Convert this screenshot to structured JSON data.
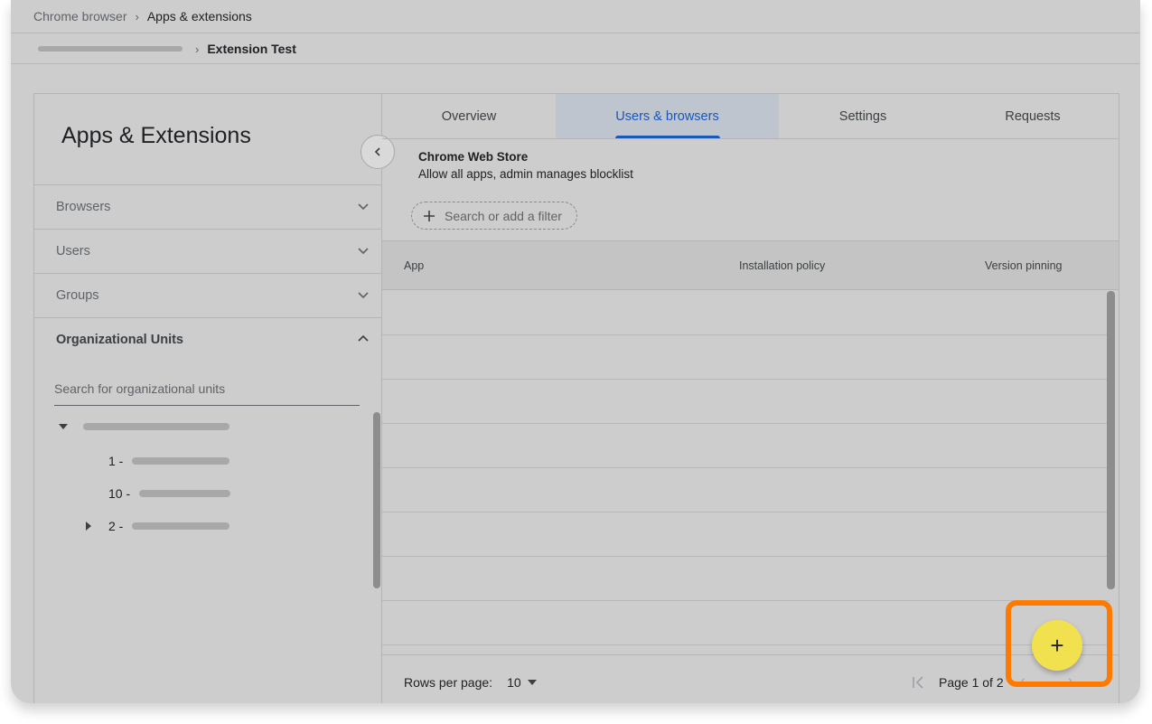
{
  "breadcrumb": {
    "root": "Chrome browser",
    "separator": "›",
    "current": "Apps & extensions"
  },
  "sub_breadcrumb": {
    "separator": "›",
    "current": "Extension Test"
  },
  "sidebar": {
    "title": "Apps & Extensions",
    "items": [
      {
        "label": "Browsers",
        "expanded": false
      },
      {
        "label": "Users",
        "expanded": false
      },
      {
        "label": "Groups",
        "expanded": false
      },
      {
        "label": "Organizational Units",
        "expanded": true
      }
    ],
    "ou_search_placeholder": "Search for organizational units",
    "tree": [
      {
        "prefix": "",
        "level": 0,
        "arrow": "down"
      },
      {
        "prefix": "1 -",
        "level": 1,
        "arrow": ""
      },
      {
        "prefix": "10 -",
        "level": 1,
        "arrow": ""
      },
      {
        "prefix": "2 -",
        "level": 1,
        "arrow": "right"
      }
    ]
  },
  "tabs": [
    {
      "label": "Overview",
      "active": false
    },
    {
      "label": "Users & browsers",
      "active": true
    },
    {
      "label": "Settings",
      "active": false
    },
    {
      "label": "Requests",
      "active": false
    }
  ],
  "store": {
    "title": "Chrome Web Store",
    "subtitle": "Allow all apps, admin manages blocklist"
  },
  "filter": {
    "label": "Search or add a filter"
  },
  "table": {
    "columns": [
      "App",
      "Installation policy",
      "Version pinning"
    ]
  },
  "footer": {
    "rows_per_page_label": "Rows per page:",
    "rows_per_page_value": "10",
    "page_label": "Page 1 of 2"
  },
  "fab": {
    "symbol": "+"
  },
  "colors": {
    "active_tab": "#1a57b6",
    "fab": "#f2e14e",
    "highlight": "#ff7a00"
  }
}
